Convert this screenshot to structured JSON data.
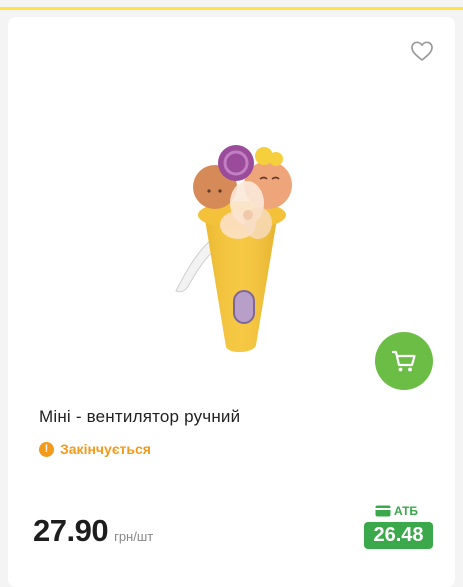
{
  "product": {
    "title": "Міні - вентилятор ручний",
    "status": "Закінчується",
    "price": "27.90",
    "unit": "грн/шт",
    "atb_label": "АТБ",
    "atb_price": "26.48"
  },
  "icons": {
    "favorite": "heart-outline-icon",
    "cart": "cart-icon",
    "status": "warning-icon",
    "atb_card": "card-icon"
  },
  "colors": {
    "accent_yellow": "#ffe14a",
    "cart_green": "#6cbd46",
    "atb_green": "#3aa84b",
    "warning_orange": "#f29a1c"
  }
}
